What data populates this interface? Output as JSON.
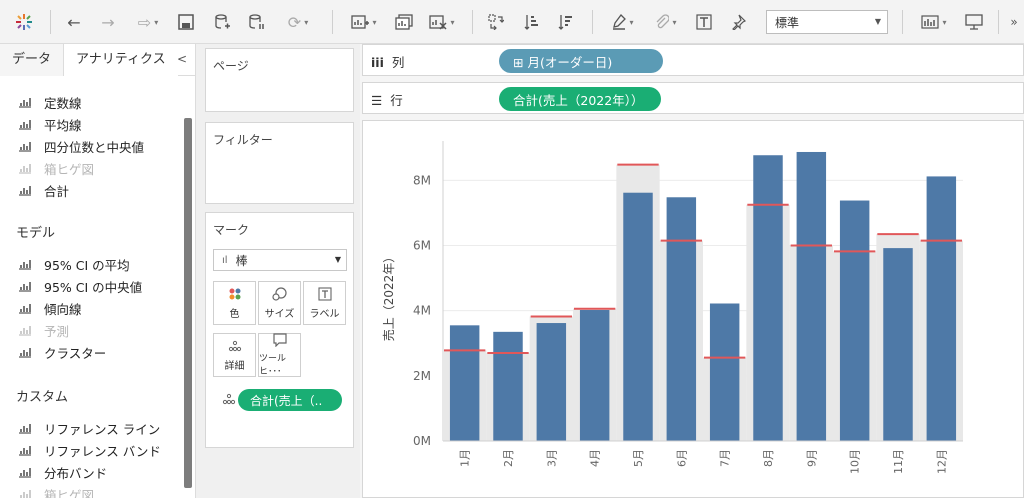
{
  "toolbar": {
    "fit_value": "標準"
  },
  "left_panel": {
    "tabs": [
      "データ",
      "アナリティクス"
    ],
    "sections": [
      {
        "title": "",
        "items": [
          {
            "label": "定数線",
            "icon": "constant-line-icon",
            "disabled": false
          },
          {
            "label": "平均線",
            "icon": "average-line-icon",
            "disabled": false
          },
          {
            "label": "四分位数と中央値",
            "icon": "quartile-icon",
            "disabled": false
          },
          {
            "label": "箱ヒゲ図",
            "icon": "box-plot-icon",
            "disabled": true
          },
          {
            "label": "合計",
            "icon": "totals-icon",
            "disabled": false
          }
        ]
      },
      {
        "title": "モデル",
        "items": [
          {
            "label": "95% CI の平均",
            "icon": "ci-icon",
            "disabled": false
          },
          {
            "label": "95% CI の中央値",
            "icon": "ci-icon",
            "disabled": false
          },
          {
            "label": "傾向線",
            "icon": "trend-line-icon",
            "disabled": false
          },
          {
            "label": "予測",
            "icon": "forecast-icon",
            "disabled": true
          },
          {
            "label": "クラスター",
            "icon": "cluster-icon",
            "disabled": false
          }
        ]
      },
      {
        "title": "カスタム",
        "items": [
          {
            "label": "リファレンス ライン",
            "icon": "reference-line-icon",
            "disabled": false
          },
          {
            "label": "リファレンス バンド",
            "icon": "reference-band-icon",
            "disabled": false
          },
          {
            "label": "分布バンド",
            "icon": "distribution-band-icon",
            "disabled": false
          },
          {
            "label": "箱ヒゲ図",
            "icon": "box-plot-icon",
            "disabled": true
          }
        ]
      }
    ]
  },
  "cards": {
    "pages": "ページ",
    "filters": "フィルター",
    "marks": "マーク",
    "mark_type": "棒",
    "mark_buttons": [
      "色",
      "サイズ",
      "ラベル",
      "詳細",
      "ツールヒ･･･"
    ],
    "mark_pill": "合計(売上（.."
  },
  "shelves": {
    "columns_label": "列",
    "rows_label": "行",
    "columns_pill": "⊞ 月(オーダー日)",
    "rows_pill": "合計(売上（2022年））",
    "columns_pill_color": "#5b9bb5",
    "rows_pill_color": "#1aae74"
  },
  "chart_data": {
    "type": "bar",
    "categories": [
      "1月",
      "2月",
      "3月",
      "4月",
      "5月",
      "6月",
      "7月",
      "8月",
      "9月",
      "10月",
      "11月",
      "12月"
    ],
    "values": [
      3.55,
      3.35,
      3.62,
      4.02,
      7.62,
      7.48,
      4.22,
      8.77,
      8.87,
      7.38,
      5.92,
      8.12
    ],
    "reference_values": [
      2.78,
      2.7,
      3.82,
      4.06,
      8.48,
      6.15,
      2.56,
      7.25,
      6.0,
      5.82,
      6.35,
      6.15
    ],
    "ylabel": "売上（2022年）",
    "ylim": [
      0,
      8.9
    ],
    "yticks": [
      "0M",
      "2M",
      "4M",
      "6M",
      "8M"
    ],
    "bar_color": "#4e79a7",
    "reference_line_color": "#e15759",
    "band_color": "#e8e8e8"
  }
}
